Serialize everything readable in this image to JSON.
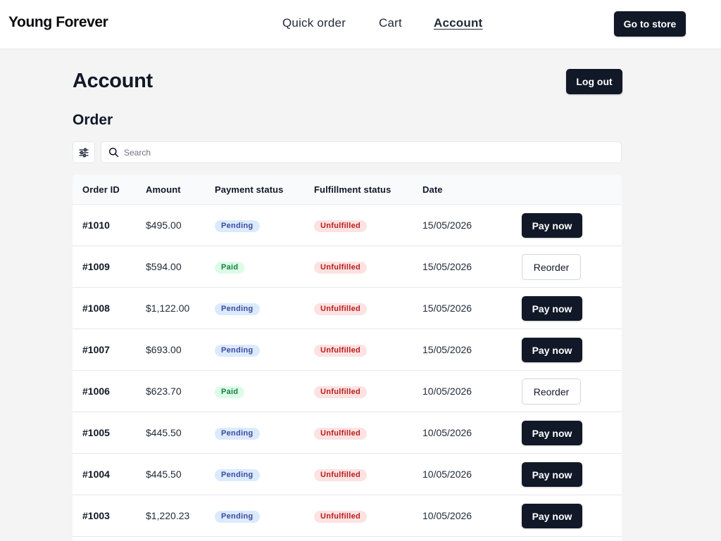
{
  "header": {
    "brand": "Young Forever",
    "nav": [
      "Quick order",
      "Cart",
      "Account"
    ],
    "active_nav": "Account",
    "go_to_store": "Go to store"
  },
  "page": {
    "title": "Account",
    "logout_label": "Log out",
    "section_title": "Order"
  },
  "search": {
    "placeholder": "Search",
    "value": ""
  },
  "icons": {
    "filter": "sliders-icon",
    "search": "search-icon"
  },
  "table": {
    "columns": [
      "Order ID",
      "Amount",
      "Payment status",
      "Fulfillment status",
      "Date"
    ],
    "rows": [
      {
        "id": "#1010",
        "amount": "$495.00",
        "payment": "Pending",
        "fulfillment": "Unfulfilled",
        "date": "15/05/2026",
        "action": "Pay now"
      },
      {
        "id": "#1009",
        "amount": "$594.00",
        "payment": "Paid",
        "fulfillment": "Unfulfilled",
        "date": "15/05/2026",
        "action": "Reorder"
      },
      {
        "id": "#1008",
        "amount": "$1,122.00",
        "payment": "Pending",
        "fulfillment": "Unfulfilled",
        "date": "15/05/2026",
        "action": "Pay now"
      },
      {
        "id": "#1007",
        "amount": "$693.00",
        "payment": "Pending",
        "fulfillment": "Unfulfilled",
        "date": "15/05/2026",
        "action": "Pay now"
      },
      {
        "id": "#1006",
        "amount": "$623.70",
        "payment": "Paid",
        "fulfillment": "Unfulfilled",
        "date": "10/05/2026",
        "action": "Reorder"
      },
      {
        "id": "#1005",
        "amount": "$445.50",
        "payment": "Pending",
        "fulfillment": "Unfulfilled",
        "date": "10/05/2026",
        "action": "Pay now"
      },
      {
        "id": "#1004",
        "amount": "$445.50",
        "payment": "Pending",
        "fulfillment": "Unfulfilled",
        "date": "10/05/2026",
        "action": "Pay now"
      },
      {
        "id": "#1003",
        "amount": "$1,220.23",
        "payment": "Pending",
        "fulfillment": "Unfulfilled",
        "date": "10/05/2026",
        "action": "Pay now"
      }
    ]
  },
  "colors": {
    "primary_button": "#111827",
    "background": "#f4f4f5",
    "pending_badge_bg": "#dbeafe",
    "paid_badge_bg": "#dcfce7",
    "unfulfilled_badge_bg": "#fde2e2"
  }
}
